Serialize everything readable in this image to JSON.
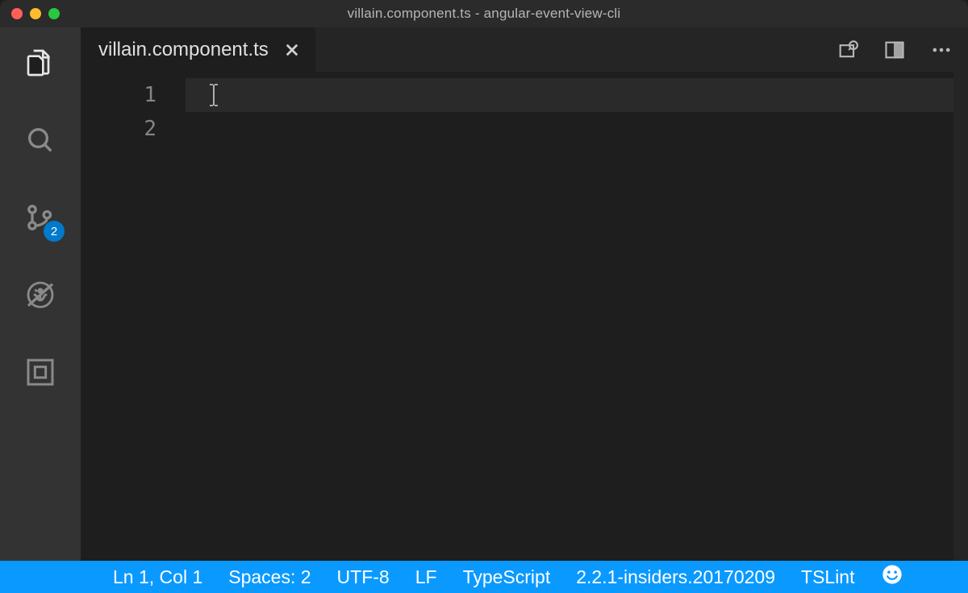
{
  "window": {
    "title": "villain.component.ts - angular-event-view-cli"
  },
  "activitybar": {
    "scm_badge": "2"
  },
  "tabs": {
    "active_label": "villain.component.ts"
  },
  "editor": {
    "lines": {
      "l1": "1",
      "l2": "2"
    }
  },
  "status": {
    "position": "Ln 1, Col 1",
    "spaces": "Spaces: 2",
    "encoding": "UTF-8",
    "eol": "LF",
    "language": "TypeScript",
    "version": "2.2.1-insiders.20170209",
    "linter": "TSLint"
  }
}
